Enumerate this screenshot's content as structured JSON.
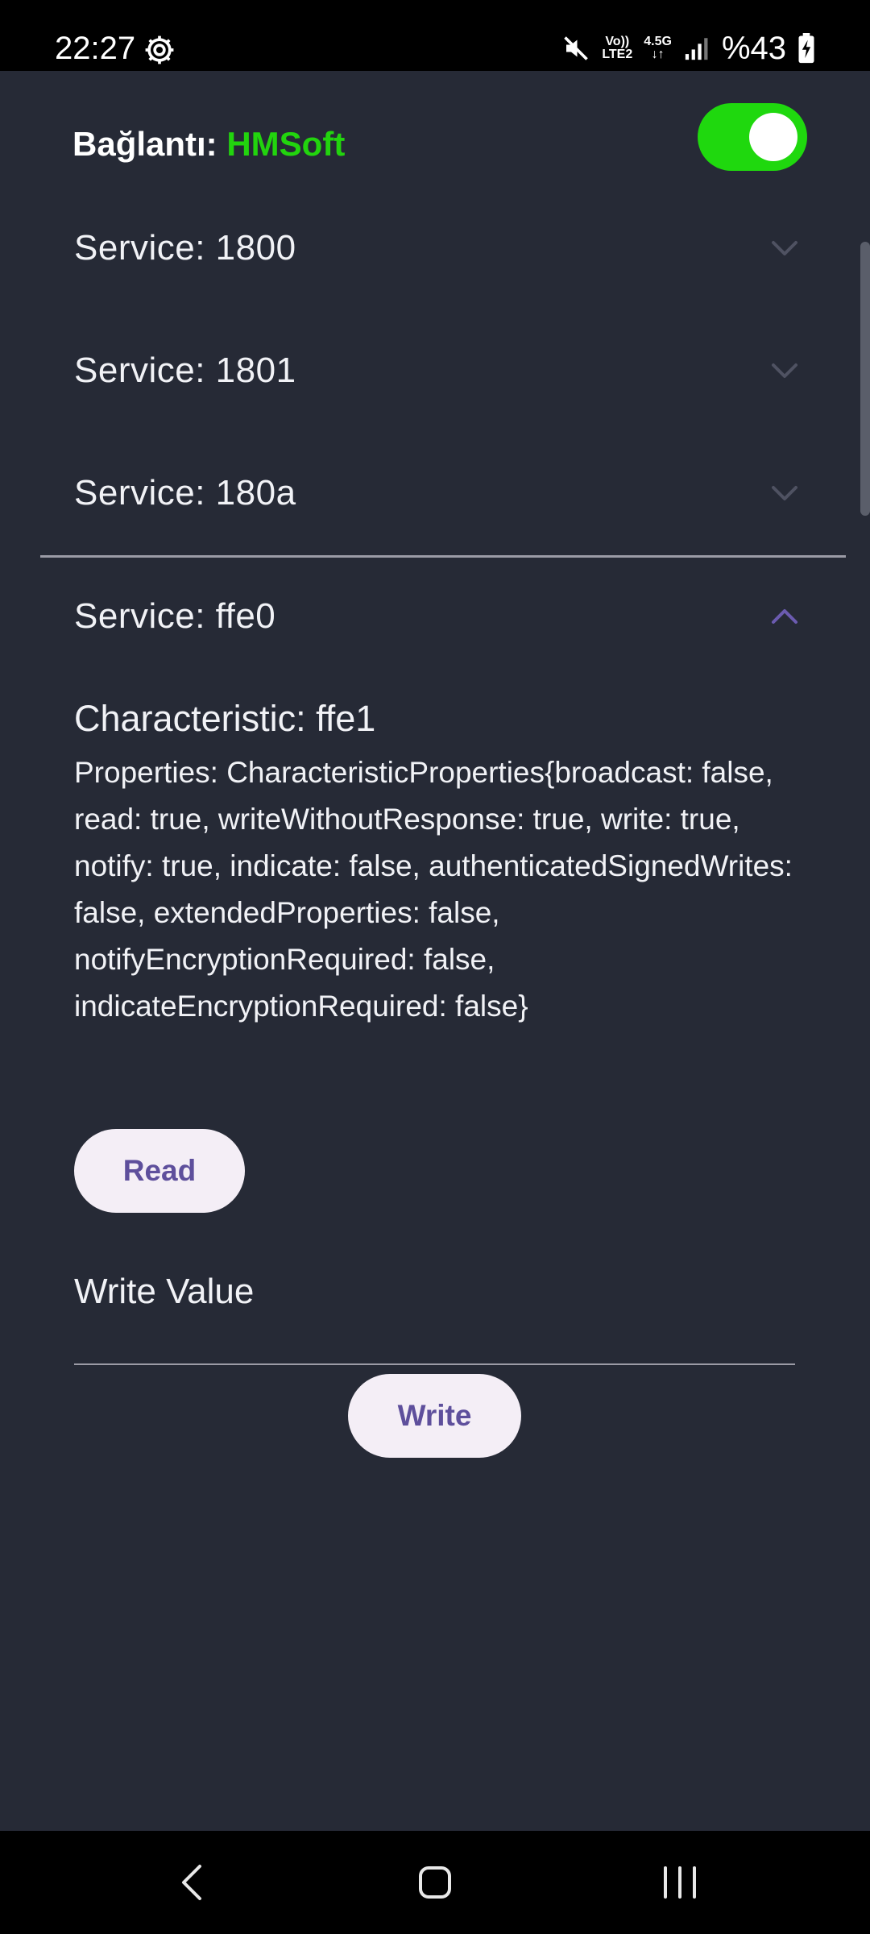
{
  "status_bar": {
    "time": "22:27",
    "network_top": "Vo))",
    "network_bottom": "LTE2",
    "data_type": "4.5G",
    "battery": "%43",
    "icons": [
      "gear-icon",
      "mute-icon",
      "signal-icon",
      "battery-charging-icon"
    ]
  },
  "header": {
    "connection_label": "Bağlantı: ",
    "device_name": "HMSoft",
    "device_name_color": "#22d40e",
    "toggle_on": true,
    "toggle_color": "#1fd80e"
  },
  "services": [
    {
      "label": "Service: 1800",
      "expanded": false
    },
    {
      "label": "Service: 1801",
      "expanded": false
    },
    {
      "label": "Service: 180a",
      "expanded": false
    },
    {
      "label": "Service: ffe0",
      "expanded": true
    }
  ],
  "characteristic": {
    "title": "Characteristic: ffe1",
    "properties": "Properties: CharacteristicProperties{broadcast: false, read: true, writeWithoutResponse: true, write: true, notify: true, indicate: false, authenticatedSignedWrites: false, extendedProperties: false, notifyEncryptionRequired: false, indicateEncryptionRequired: false}",
    "read_label": "Read",
    "write_placeholder": "Write Value",
    "write_label": "Write"
  },
  "colors": {
    "background": "#262a36",
    "accent": "#6b5bb0",
    "button_bg": "#f4eef6",
    "button_text": "#5e4f9c"
  }
}
